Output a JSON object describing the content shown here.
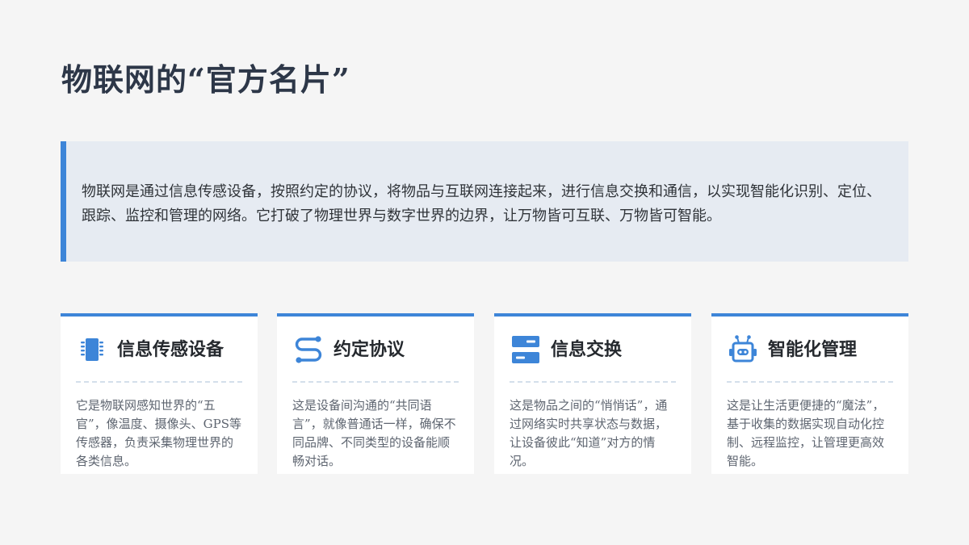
{
  "title": "物联网的“官方名片”",
  "intro": "物联网是通过信息传感设备，按照约定的协议，将物品与互联网连接起来，进行信息交换和通信，以实现智能化识别、定位、跟踪、监控和管理的网络。它打破了物理世界与数字世界的边界，让万物皆可互联、万物皆可智能。",
  "colors": {
    "accent": "#3d85d8",
    "intro_bg": "#e6ebf2",
    "page_bg": "#f5f5f5"
  },
  "cards": [
    {
      "icon": "chip-icon",
      "title": "信息传感设备",
      "text": "它是物联网感知世界的“五官”，像温度、摄像头、GPS等传感器，负责采集物理世界的各类信息。"
    },
    {
      "icon": "route-icon",
      "title": "约定协议",
      "text": "这是设备间沟通的“共同语言”，就像普通话一样，确保不同品牌、不同类型的设备能顺畅对话。"
    },
    {
      "icon": "server-icon",
      "title": "信息交换",
      "text": "这是物品之间的“悄悄话”，通过网络实时共享状态与数据，让设备彼此“知道”对方的情况。"
    },
    {
      "icon": "robot-icon",
      "title": "智能化管理",
      "text": "这是让生活更便捷的“魔法”，基于收集的数据实现自动化控制、远程监控，让管理更高效智能。"
    }
  ]
}
